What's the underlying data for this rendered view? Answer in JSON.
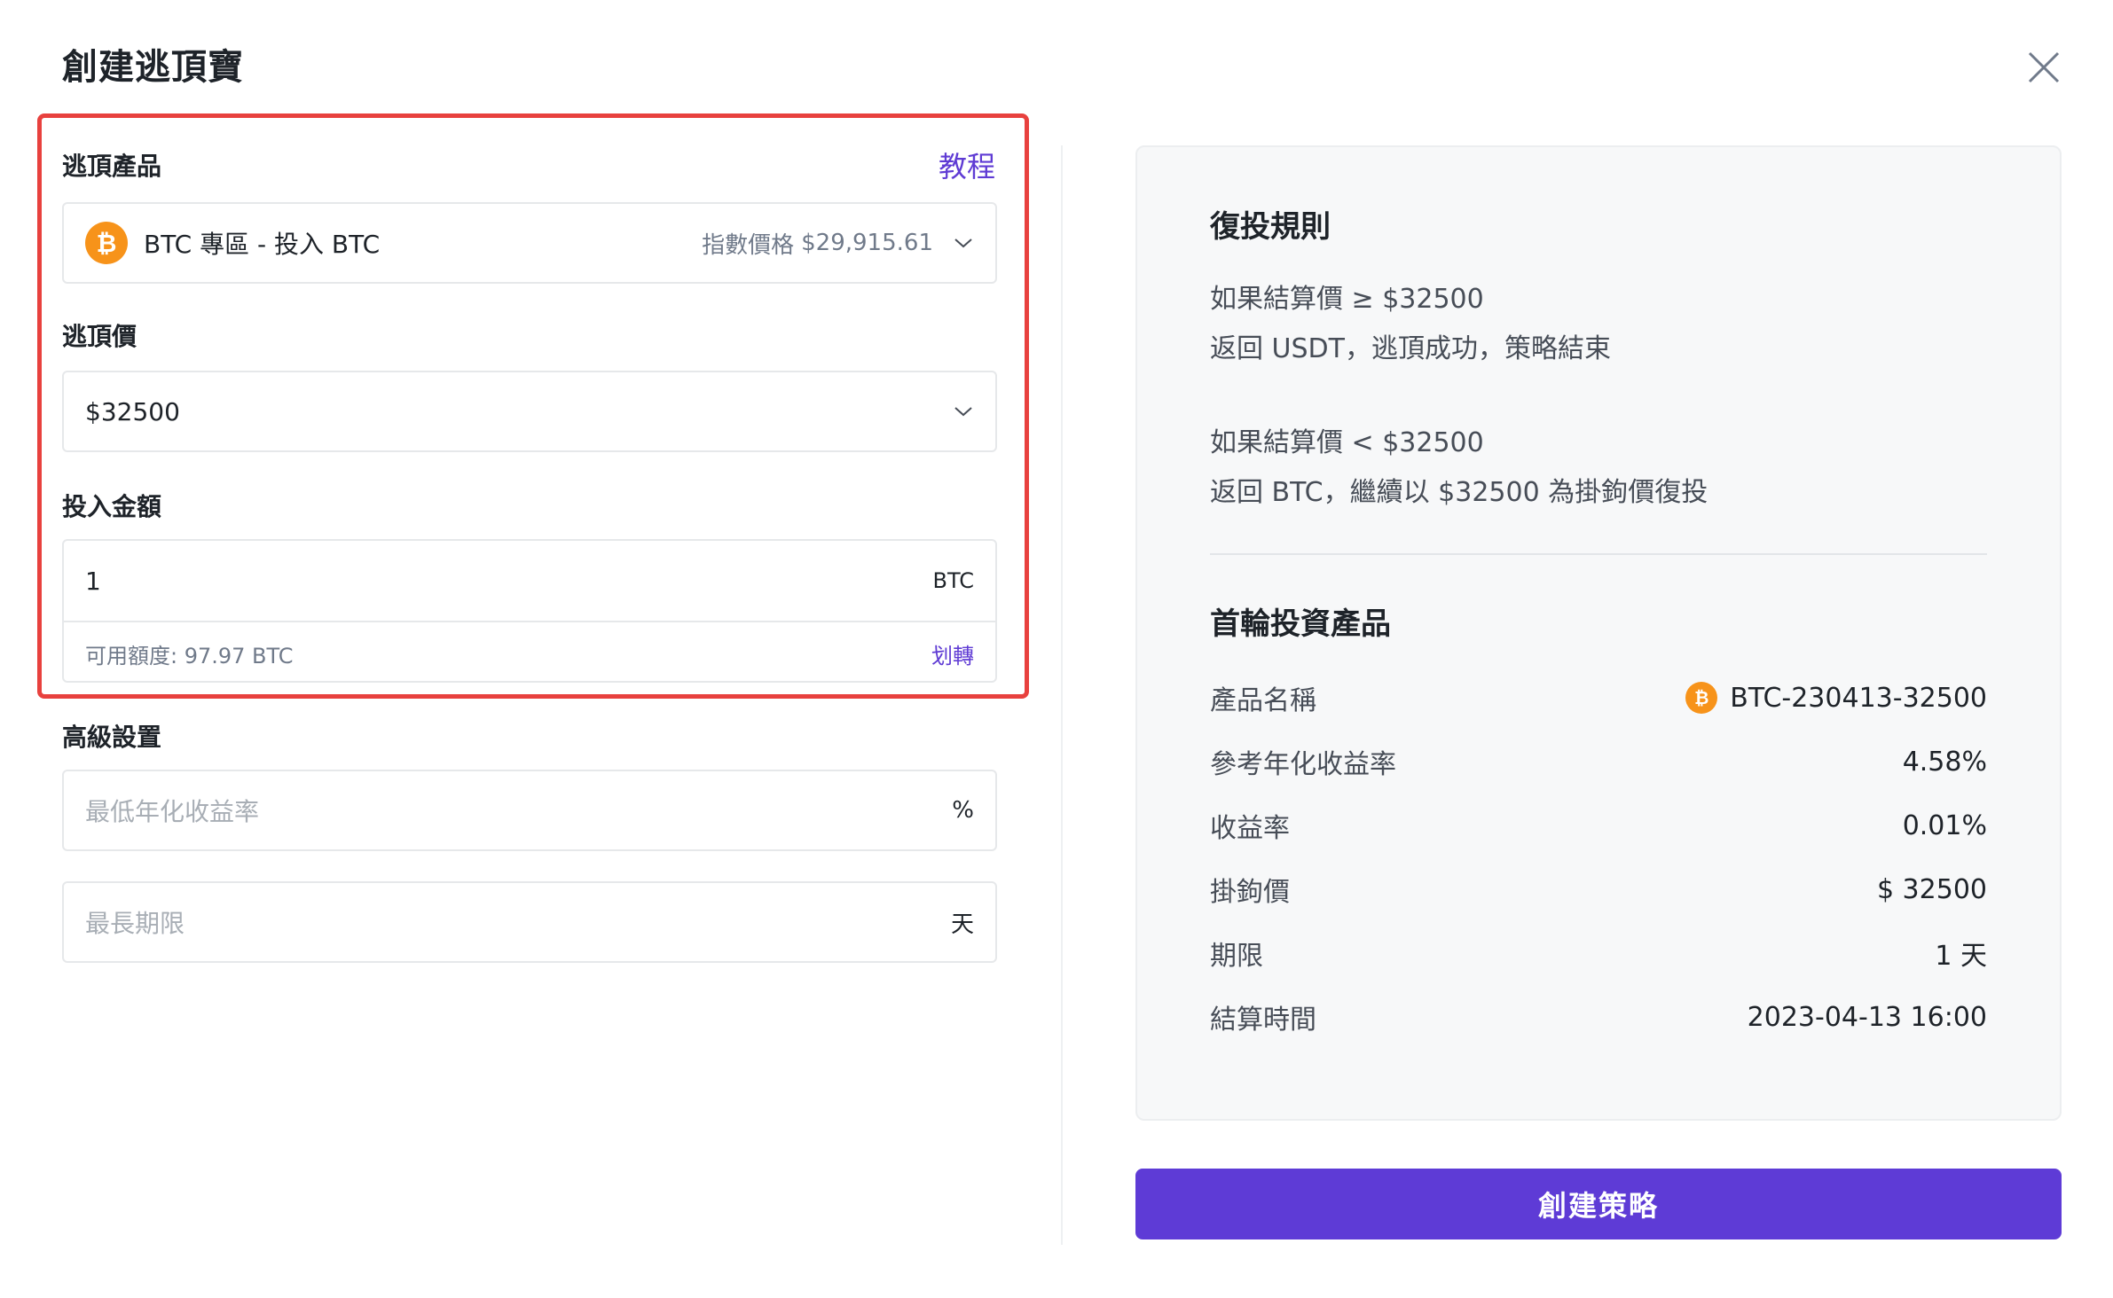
{
  "dialog": {
    "title": "創建逃頂寶"
  },
  "form": {
    "product": {
      "label": "逃頂產品",
      "tutorial_link": "教程",
      "coin_symbol": "₿",
      "selected": "BTC 專區 - 投入 BTC",
      "index_label": "指數價格",
      "index_price": "$29,915.61"
    },
    "target_price": {
      "label": "逃頂價",
      "value": "$32500"
    },
    "amount": {
      "label": "投入金額",
      "value": "1",
      "unit": "BTC",
      "available": "可用額度: 97.97 BTC",
      "transfer_link": "划轉"
    },
    "advanced": {
      "label": "高級設置",
      "min_yield_placeholder": "最低年化收益率",
      "min_yield_unit": "%",
      "max_term_placeholder": "最長期限",
      "max_term_unit": "天"
    }
  },
  "panel": {
    "rules_title": "復投規則",
    "rule1_line1": "如果結算價 ≥ $32500",
    "rule1_line2": "返回 USDT，逃頂成功，策略結束",
    "rule2_line1": "如果結算價 < $32500",
    "rule2_line2": "返回 BTC，繼續以 $32500 為掛鉤價復投",
    "product_title": "首輪投資產品",
    "details": [
      {
        "key": "產品名稱",
        "value": "BTC-230413-32500"
      },
      {
        "key": "參考年化收益率",
        "value": "4.58%"
      },
      {
        "key": "收益率",
        "value": "0.01%"
      },
      {
        "key": "掛鉤價",
        "value": "$ 32500"
      },
      {
        "key": "期限",
        "value": "1 天"
      },
      {
        "key": "結算時間",
        "value": "2023-04-13 16:00"
      }
    ]
  },
  "actions": {
    "submit_label": "創建策略"
  },
  "colors": {
    "accent": "#5e3bd6",
    "highlight": "#e8413e",
    "coin": "#f7931a"
  }
}
